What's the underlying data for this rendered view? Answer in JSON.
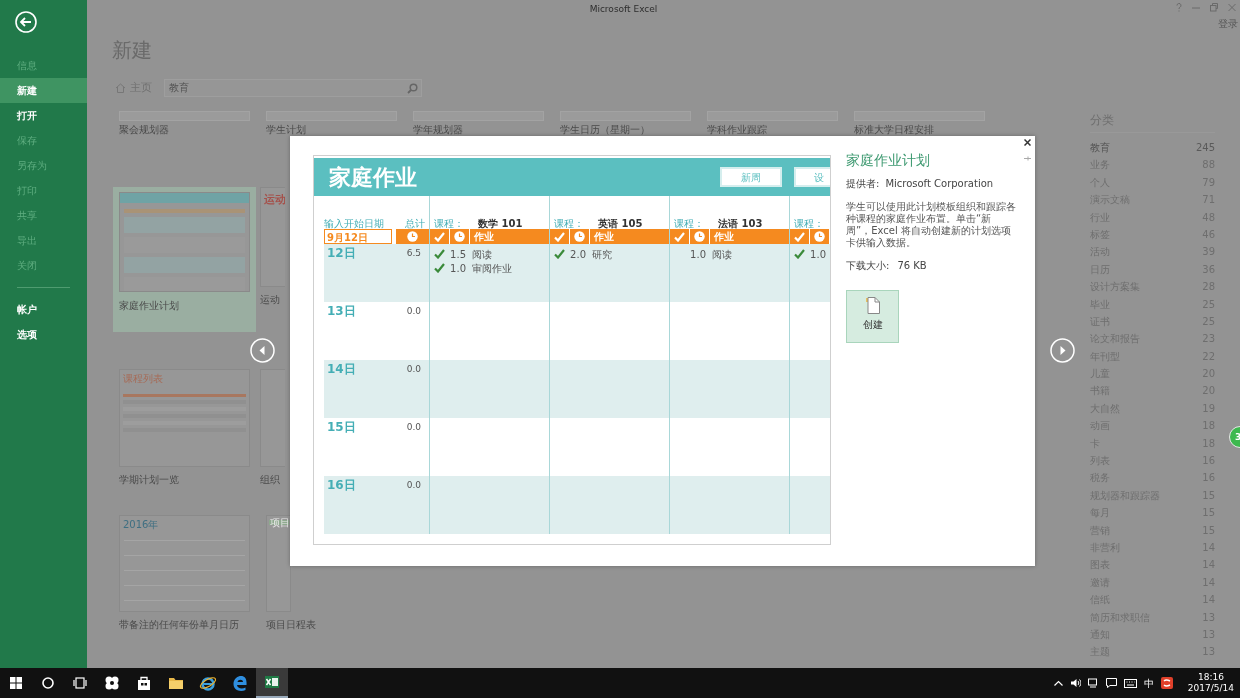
{
  "window": {
    "title": "Microsoft Excel",
    "sign_in": "登录"
  },
  "sidebar": {
    "items": [
      {
        "label": "信息",
        "disabled": true,
        "selected": false
      },
      {
        "label": "新建",
        "disabled": false,
        "selected": true
      },
      {
        "label": "打开",
        "disabled": false,
        "selected": false
      },
      {
        "label": "保存",
        "disabled": true,
        "selected": false
      },
      {
        "label": "另存为",
        "disabled": true,
        "selected": false
      },
      {
        "label": "打印",
        "disabled": true,
        "selected": false
      },
      {
        "label": "共享",
        "disabled": true,
        "selected": false
      },
      {
        "label": "导出",
        "disabled": true,
        "selected": false
      },
      {
        "label": "关闭",
        "disabled": true,
        "selected": false
      }
    ],
    "account_items": [
      {
        "label": "帐户",
        "disabled": false,
        "selected": false
      },
      {
        "label": "选项",
        "disabled": false,
        "selected": false
      }
    ]
  },
  "page_title": "新建",
  "breadcrumb": "主页",
  "search": {
    "value": "教育"
  },
  "template_rows": [
    [
      {
        "label": "聚会规划器",
        "selected": false
      },
      {
        "label": "学生计划",
        "selected": false
      },
      {
        "label": "学年规划器",
        "selected": false
      },
      {
        "label": "学生日历（星期一）",
        "selected": false
      },
      {
        "label": "学科作业跟踪",
        "selected": false
      },
      {
        "label": "标准大学日程安排",
        "selected": false
      }
    ],
    [
      {
        "label": "家庭作业计划",
        "selected": true,
        "kind": "teal"
      },
      {
        "label": "运动",
        "selected": false,
        "kind": "red",
        "thumb_title": "运动"
      }
    ],
    [
      {
        "label": "学期计划一览",
        "selected": false,
        "kind": "list",
        "thumb_title": "课程列表"
      },
      {
        "label": "组织",
        "selected": false,
        "kind": "plain"
      }
    ],
    [
      {
        "label": "带备注的任何年份单月日历",
        "selected": false,
        "kind": "calendar",
        "thumb_title": "2016年"
      },
      {
        "label": "项目日程表",
        "selected": false,
        "kind": "gantt",
        "thumb_title": "项目"
      }
    ]
  ],
  "categories": {
    "title": "分类",
    "items": [
      {
        "label": "教育",
        "count": "245",
        "selected": true
      },
      {
        "label": "业务",
        "count": "88",
        "selected": false
      },
      {
        "label": "个人",
        "count": "79",
        "selected": false
      },
      {
        "label": "演示文稿",
        "count": "71",
        "selected": false
      },
      {
        "label": "行业",
        "count": "48",
        "selected": false
      },
      {
        "label": "标签",
        "count": "46",
        "selected": false
      },
      {
        "label": "活动",
        "count": "39",
        "selected": false
      },
      {
        "label": "日历",
        "count": "36",
        "selected": false
      },
      {
        "label": "设计方案集",
        "count": "28",
        "selected": false
      },
      {
        "label": "毕业",
        "count": "25",
        "selected": false
      },
      {
        "label": "证书",
        "count": "25",
        "selected": false
      },
      {
        "label": "论文和报告",
        "count": "23",
        "selected": false
      },
      {
        "label": "年刊型",
        "count": "22",
        "selected": false
      },
      {
        "label": "儿童",
        "count": "20",
        "selected": false
      },
      {
        "label": "书籍",
        "count": "20",
        "selected": false
      },
      {
        "label": "大自然",
        "count": "19",
        "selected": false
      },
      {
        "label": "动画",
        "count": "18",
        "selected": false
      },
      {
        "label": "卡",
        "count": "18",
        "selected": false
      },
      {
        "label": "列表",
        "count": "16",
        "selected": false
      },
      {
        "label": "税务",
        "count": "16",
        "selected": false
      },
      {
        "label": "规划器和跟踪器",
        "count": "15",
        "selected": false
      },
      {
        "label": "每月",
        "count": "15",
        "selected": false
      },
      {
        "label": "营销",
        "count": "15",
        "selected": false
      },
      {
        "label": "非营利",
        "count": "14",
        "selected": false
      },
      {
        "label": "图表",
        "count": "14",
        "selected": false
      },
      {
        "label": "邀请",
        "count": "14",
        "selected": false
      },
      {
        "label": "信纸",
        "count": "14",
        "selected": false
      },
      {
        "label": "简历和求职信",
        "count": "13",
        "selected": false
      },
      {
        "label": "通知",
        "count": "13",
        "selected": false
      },
      {
        "label": "主题",
        "count": "13",
        "selected": false
      }
    ]
  },
  "preview": {
    "title": "家庭作业",
    "buttons": [
      "新周",
      "设"
    ],
    "date_header": "输入开始日期",
    "total_header": "总计",
    "start_date": "9月12日",
    "courses": [
      {
        "label": "课程：",
        "name": "数学 101",
        "task_header": "作业"
      },
      {
        "label": "课程：",
        "name": "英语 105",
        "task_header": "作业"
      },
      {
        "label": "课程：",
        "name": "法语 103",
        "task_header": "作业"
      },
      {
        "label": "课程："
      }
    ],
    "days": [
      {
        "day": "12日",
        "total": "6.5",
        "shaded": true,
        "entries": [
          [
            {
              "done": true,
              "hours": "1.5",
              "task": "阅读"
            },
            {
              "done": true,
              "hours": "1.0",
              "task": "审阅作业"
            }
          ],
          [
            {
              "done": true,
              "hours": "2.0",
              "task": "研究"
            }
          ],
          [
            {
              "done": false,
              "hours": "1.0",
              "task": "阅读"
            }
          ],
          [
            {
              "done": true,
              "hours": "1.0"
            }
          ]
        ]
      },
      {
        "day": "13日",
        "total": "0.0",
        "shaded": false
      },
      {
        "day": "14日",
        "total": "0.0",
        "shaded": true
      },
      {
        "day": "15日",
        "total": "0.0",
        "shaded": false
      },
      {
        "day": "16日",
        "total": "0.0",
        "shaded": true
      }
    ]
  },
  "details": {
    "title": "家庭作业计划",
    "provider_label": "提供者:",
    "provider": "Microsoft Corporation",
    "description": "学生可以使用此计划模板组织和跟踪各种课程的家庭作业布置。单击“新周”，Excel 将自动创建新的计划选项卡供输入数据。",
    "download_label": "下载大小:",
    "download_size": "76 KB",
    "create_button": "创建"
  },
  "floating_badge": "3",
  "taskbar": {
    "apps": [
      {
        "kind": "start",
        "active": false
      },
      {
        "kind": "search",
        "active": false
      },
      {
        "kind": "taskview",
        "active": false
      },
      {
        "kind": "flower",
        "active": false
      },
      {
        "kind": "store",
        "active": false
      },
      {
        "kind": "folder",
        "active": false
      },
      {
        "kind": "ie",
        "active": false
      },
      {
        "kind": "edge",
        "active": false
      },
      {
        "kind": "excel",
        "active": true
      }
    ],
    "ime": "中",
    "time": "18:16",
    "date": "2017/5/14"
  }
}
